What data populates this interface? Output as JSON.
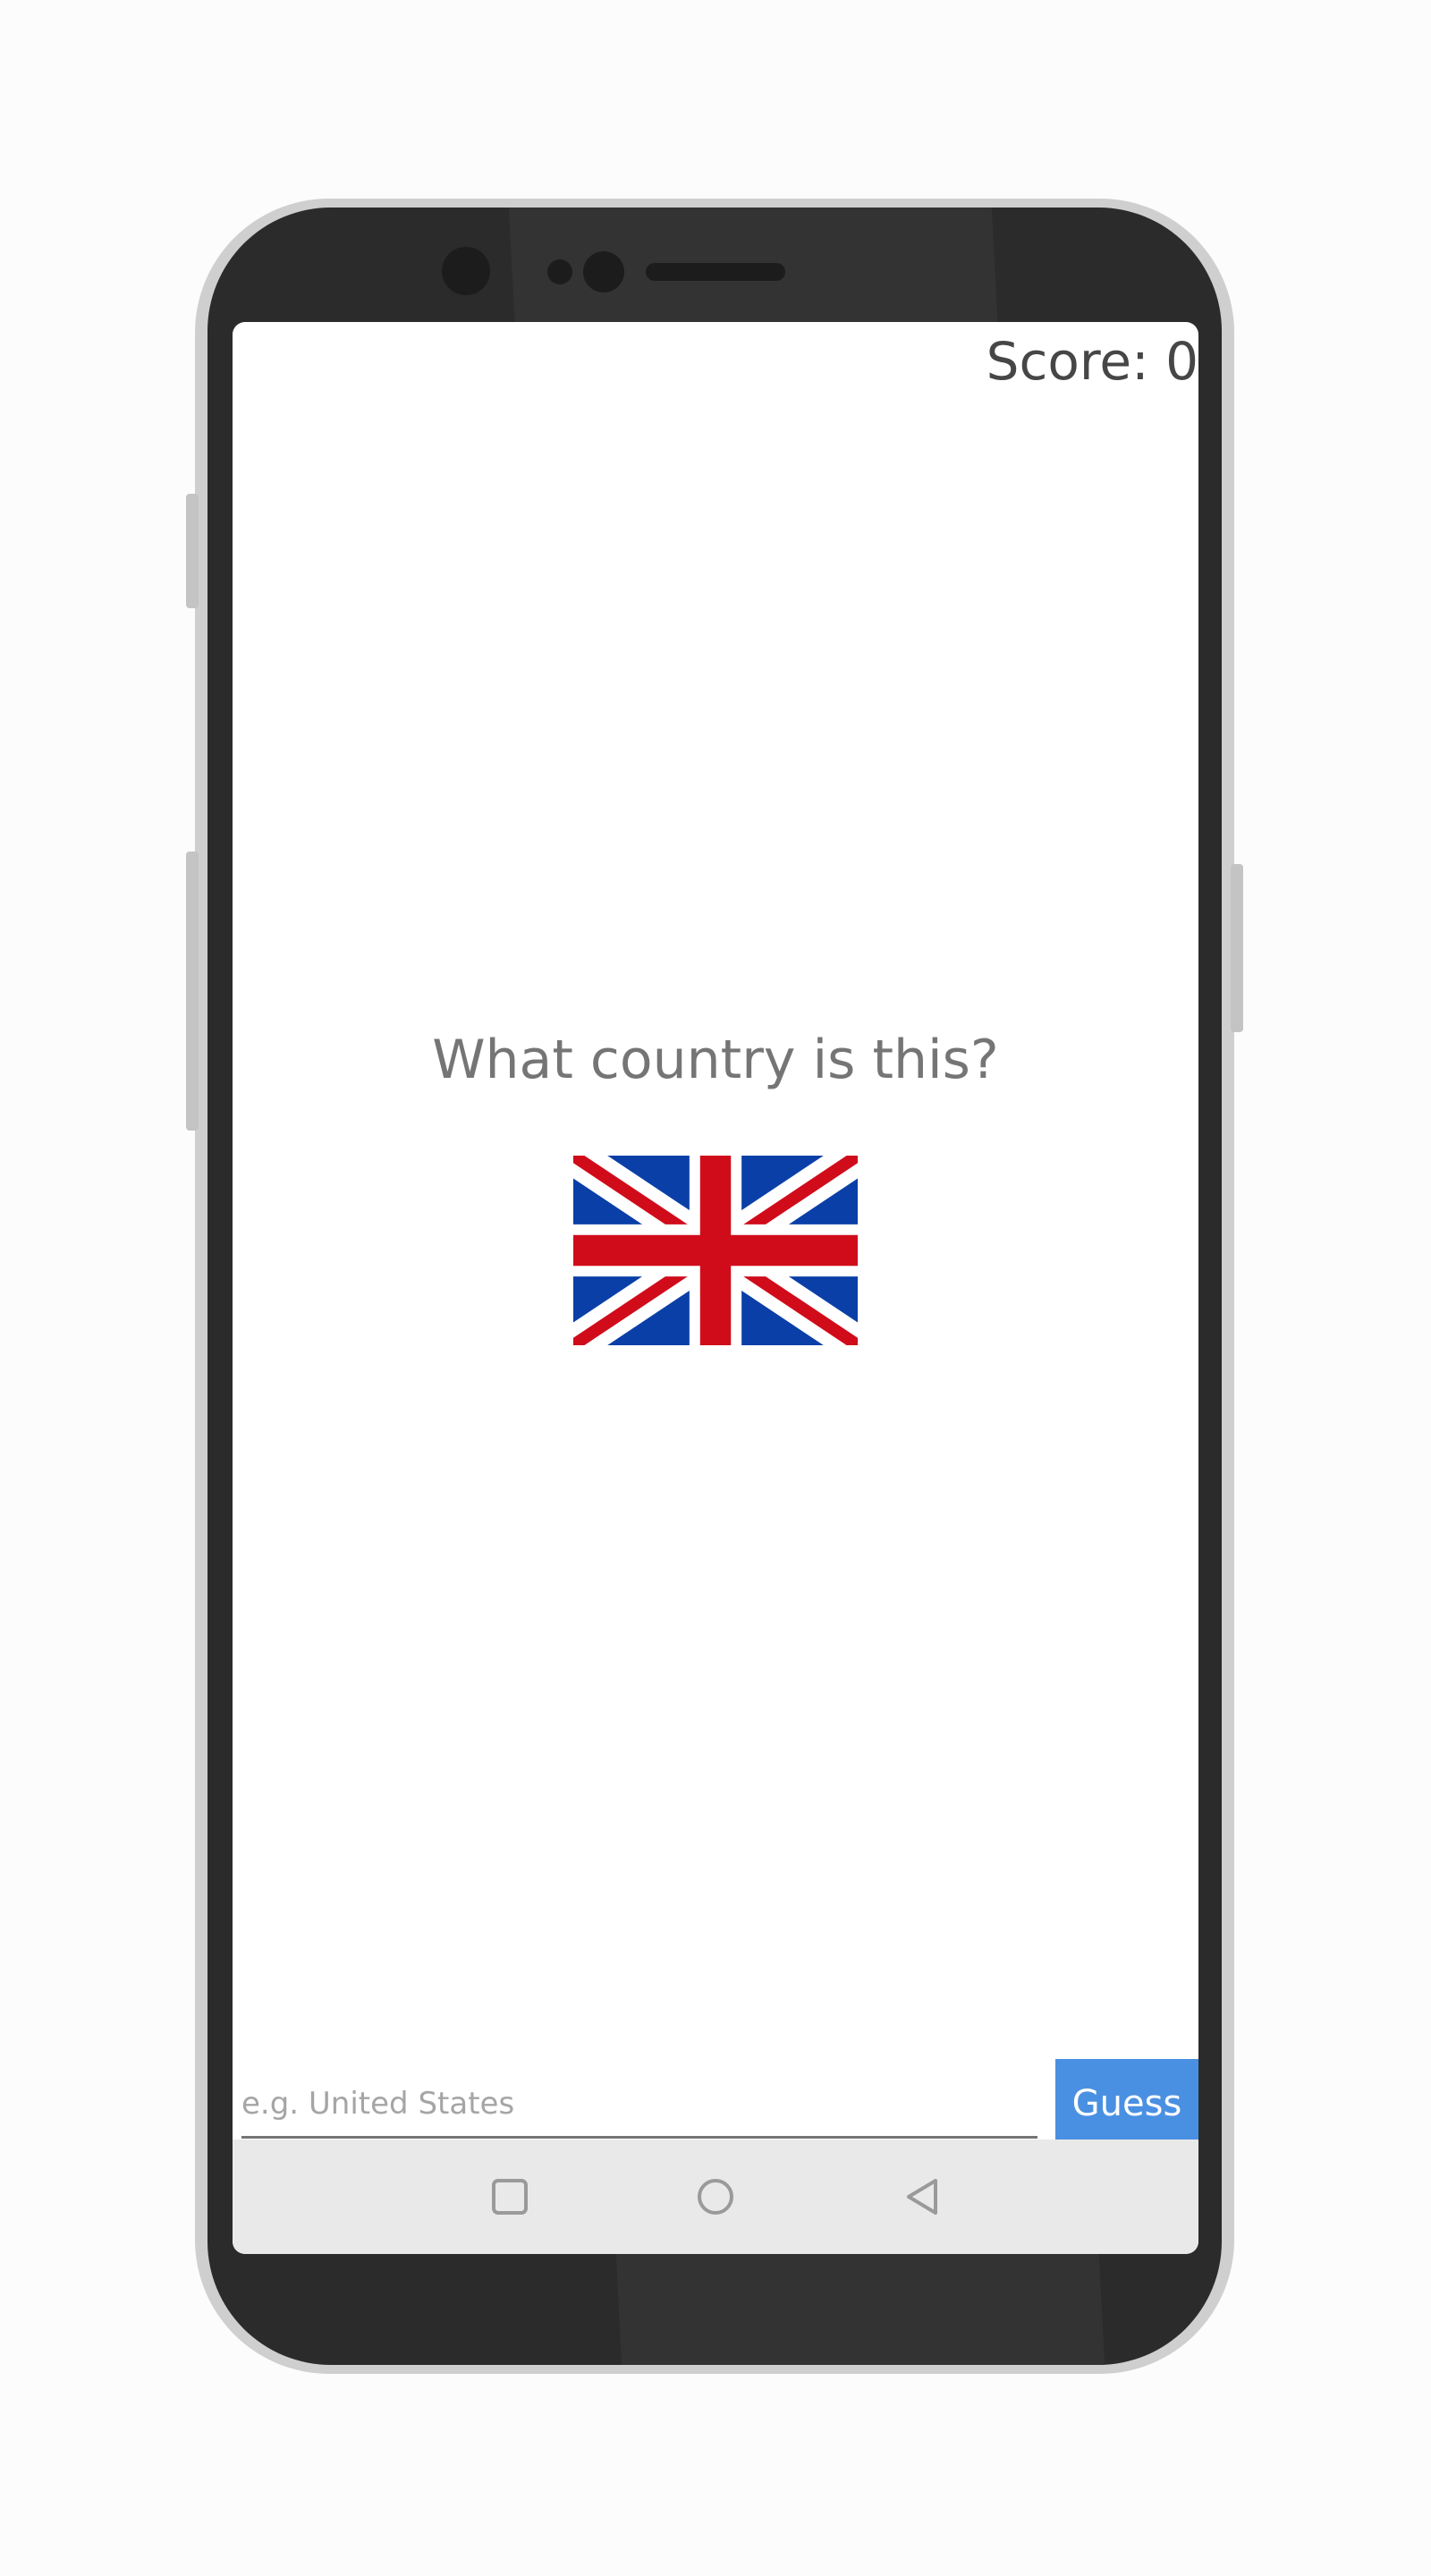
{
  "header": {
    "score_text": "Score: 0"
  },
  "main": {
    "question": "What country is this?",
    "flag_icon": "united-kingdom-flag"
  },
  "input": {
    "placeholder": "e.g. United States",
    "value": "",
    "guess_label": "Guess"
  },
  "colors": {
    "accent": "#4a90e2",
    "flag_blue": "#0a3fa8",
    "flag_red": "#d00c1b",
    "navbar_bg": "#e9e9e9"
  },
  "navbar": {
    "icons": [
      "square-icon",
      "circle-icon",
      "back-triangle-icon"
    ]
  }
}
